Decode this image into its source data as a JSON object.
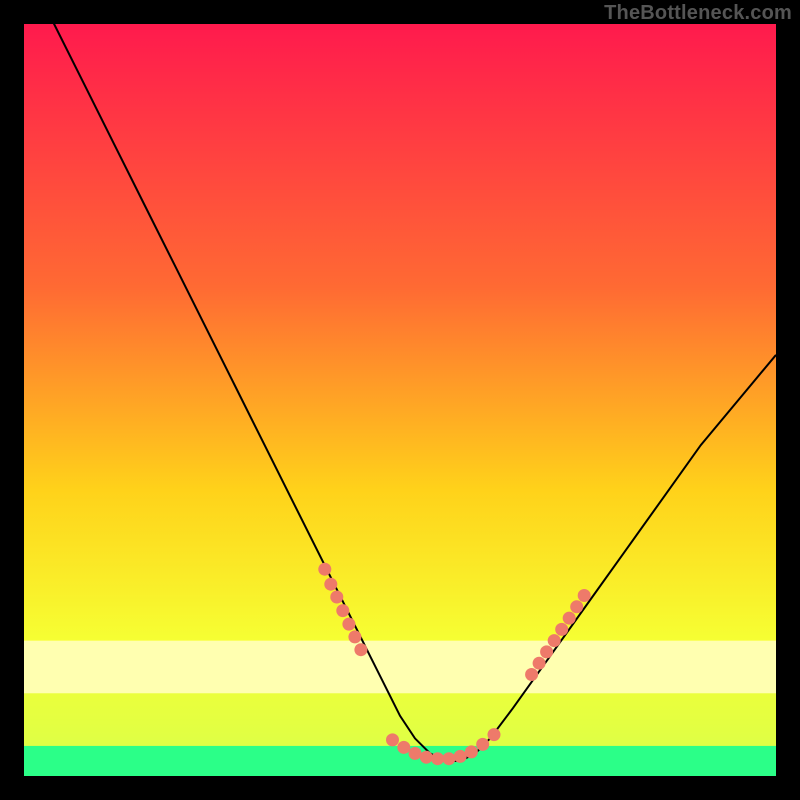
{
  "credit": "TheBottleneck.com",
  "colors": {
    "top": "#ff1a4d",
    "mid1": "#ff6a33",
    "mid2": "#ffd21a",
    "mid3": "#f6ff33",
    "band_pale": "#ffffb0",
    "bottom_green": "#2bff88",
    "curve": "#000000",
    "dots": "#ee7a6a",
    "background": "#000000"
  },
  "chart_data": {
    "type": "line",
    "title": "",
    "xlabel": "",
    "ylabel": "",
    "xlim": [
      0,
      100
    ],
    "ylim": [
      0,
      100
    ],
    "curve": {
      "x": [
        0,
        4,
        8,
        12,
        16,
        20,
        24,
        28,
        32,
        36,
        40,
        44,
        46,
        48,
        50,
        52,
        54,
        56,
        58,
        60,
        62,
        65,
        70,
        75,
        80,
        85,
        90,
        95,
        100
      ],
      "y": [
        108,
        100,
        92,
        84,
        76,
        68,
        60,
        52,
        44,
        36,
        28,
        20,
        16,
        12,
        8,
        5,
        3,
        2,
        2,
        3,
        5,
        9,
        16,
        23,
        30,
        37,
        44,
        50,
        56
      ]
    },
    "dot_clusters": [
      {
        "name": "left-shoulder",
        "points": [
          {
            "x": 40.0,
            "y": 27.5
          },
          {
            "x": 40.8,
            "y": 25.5
          },
          {
            "x": 41.6,
            "y": 23.8
          },
          {
            "x": 42.4,
            "y": 22.0
          },
          {
            "x": 43.2,
            "y": 20.2
          },
          {
            "x": 44.0,
            "y": 18.5
          },
          {
            "x": 44.8,
            "y": 16.8
          }
        ]
      },
      {
        "name": "valley-floor",
        "points": [
          {
            "x": 49.0,
            "y": 4.8
          },
          {
            "x": 50.5,
            "y": 3.8
          },
          {
            "x": 52.0,
            "y": 3.0
          },
          {
            "x": 53.5,
            "y": 2.5
          },
          {
            "x": 55.0,
            "y": 2.3
          },
          {
            "x": 56.5,
            "y": 2.3
          },
          {
            "x": 58.0,
            "y": 2.6
          },
          {
            "x": 59.5,
            "y": 3.2
          },
          {
            "x": 61.0,
            "y": 4.2
          },
          {
            "x": 62.5,
            "y": 5.5
          }
        ]
      },
      {
        "name": "right-shoulder",
        "points": [
          {
            "x": 67.5,
            "y": 13.5
          },
          {
            "x": 68.5,
            "y": 15.0
          },
          {
            "x": 69.5,
            "y": 16.5
          },
          {
            "x": 70.5,
            "y": 18.0
          },
          {
            "x": 71.5,
            "y": 19.5
          },
          {
            "x": 72.5,
            "y": 21.0
          },
          {
            "x": 73.5,
            "y": 22.5
          },
          {
            "x": 74.5,
            "y": 24.0
          }
        ]
      }
    ],
    "bands": [
      {
        "name": "pale-yellow",
        "y0": 11,
        "y1": 18
      },
      {
        "name": "green",
        "y0": 0,
        "y1": 4
      }
    ]
  }
}
